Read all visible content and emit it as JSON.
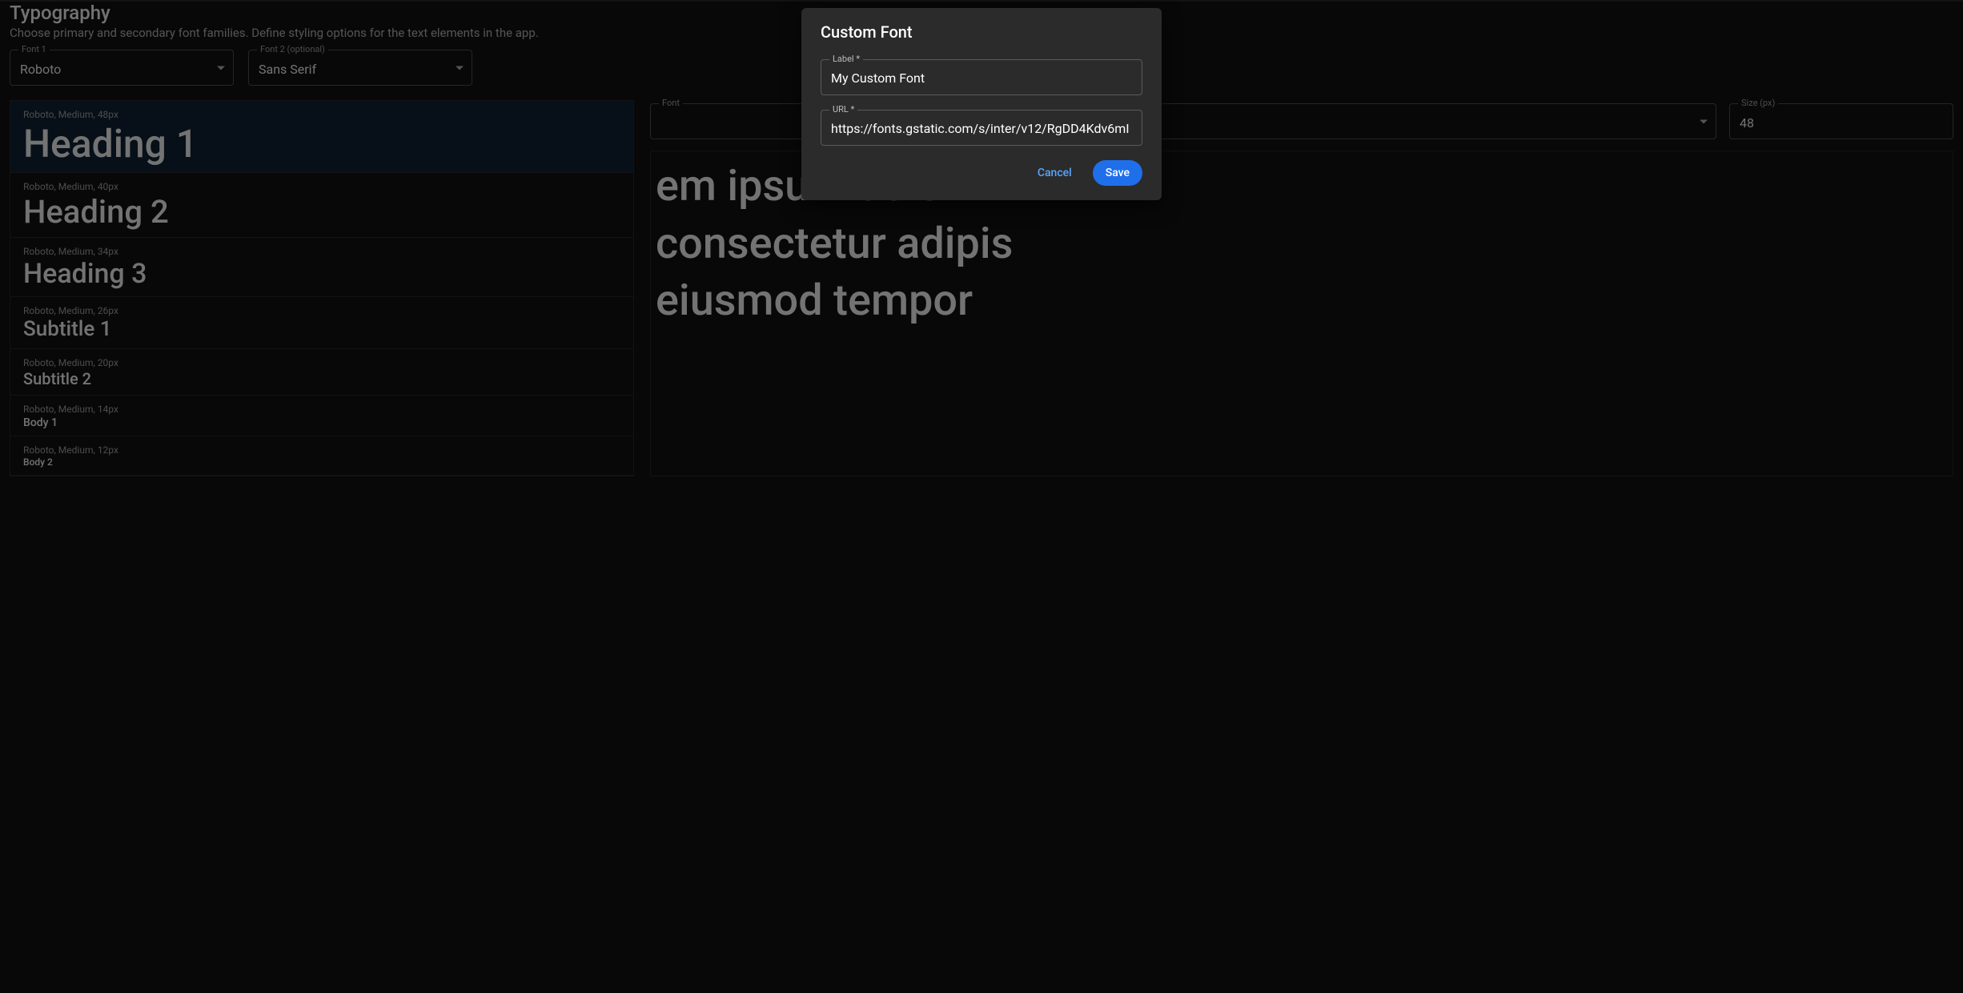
{
  "header": {
    "title": "Typography",
    "subtitle": "Choose primary and secondary font families. Define styling options for the text elements in the app."
  },
  "fontSelectors": {
    "font1": {
      "label": "Font 1",
      "value": "Roboto"
    },
    "font2": {
      "label": "Font 2 (optional)",
      "value": "Sans Serif"
    }
  },
  "styles": [
    {
      "meta": "Roboto, Medium, 48px",
      "name": "Heading 1",
      "sizeClass": "s48",
      "active": true
    },
    {
      "meta": "Roboto, Medium, 40px",
      "name": "Heading 2",
      "sizeClass": "s40",
      "active": false
    },
    {
      "meta": "Roboto, Medium, 34px",
      "name": "Heading 3",
      "sizeClass": "s34",
      "active": false
    },
    {
      "meta": "Roboto, Medium, 26px",
      "name": "Subtitle 1",
      "sizeClass": "s26",
      "active": false
    },
    {
      "meta": "Roboto, Medium, 20px",
      "name": "Subtitle 2",
      "sizeClass": "s20",
      "active": false
    },
    {
      "meta": "Roboto, Medium, 14px",
      "name": "Body 1",
      "sizeClass": "s14",
      "active": false
    },
    {
      "meta": "Roboto, Medium, 12px",
      "name": "Body 2",
      "sizeClass": "s12",
      "active": false
    }
  ],
  "controls": {
    "font": {
      "label": "Font",
      "value": ""
    },
    "size": {
      "label": "Size (px)",
      "value": "48"
    }
  },
  "preview": {
    "line1": "em ipsum dolor ",
    "line2": "consectetur adipis",
    "line3": "eiusmod tempor"
  },
  "dialog": {
    "title": "Custom Font",
    "labelField": {
      "label": "Label *",
      "value": "My Custom Font"
    },
    "urlField": {
      "label": "URL *",
      "value": "https://fonts.gstatic.com/s/inter/v12/RgDD4Kdv6mI"
    },
    "cancel": "Cancel",
    "save": "Save"
  }
}
